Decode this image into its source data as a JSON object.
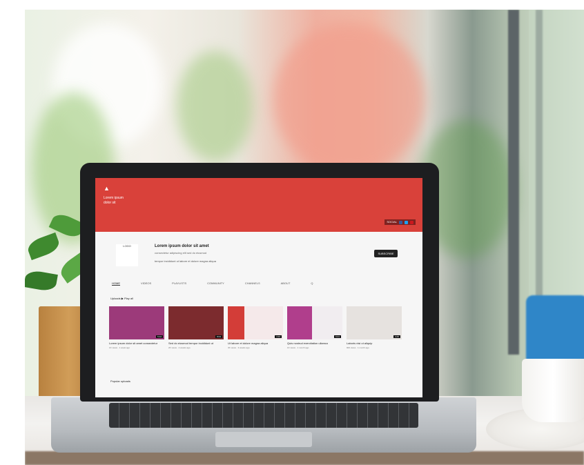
{
  "banner": {
    "logo_glyph": "▲",
    "brand_line_1": "Lorem ipsum",
    "brand_line_2": "dolor sit",
    "links": [
      "SOCIAL",
      "f",
      "t",
      "▶"
    ],
    "social_colors": [
      "#3b5998",
      "#1da1f2",
      "#cc181e"
    ]
  },
  "channel": {
    "avatar_text": "LOGO",
    "title": "Lorem ipsum dolor sit amet",
    "subtitle": "consectetur adipiscing elit sed do eiusmod",
    "description": "tempor incididunt ut labore et dolore magna aliqua",
    "subscribe_label": "SUBSCRIBE"
  },
  "tabs": [
    "HOME",
    "VIDEOS",
    "PLAYLISTS",
    "COMMUNITY",
    "CHANNELS",
    "ABOUT",
    "Q"
  ],
  "section_title": "Uploads ▶ Play all",
  "videos": [
    {
      "title": "Lorem ipsum dolor sit amet consectetur",
      "meta": "1K views · 1 week ago",
      "duration": "5:12",
      "thumb_color": "#9c3a7a"
    },
    {
      "title": "Sed do eiusmod tempor incididunt ut",
      "meta": "2K views · 2 weeks ago",
      "duration": "8:04",
      "thumb_color": "#7c2b2e"
    },
    {
      "title": "Ut labore et dolore magna aliqua",
      "meta": "3K views · 3 weeks ago",
      "duration": "4:33",
      "thumb_color": "#d33d38"
    },
    {
      "title": "Quis nostrud exercitation ullamco",
      "meta": "1K views · 1 month ago",
      "duration": "6:21",
      "thumb_color": "#b03e8c"
    },
    {
      "title": "Laboris nisi ut aliquip",
      "meta": "900 views · 1 month ago",
      "duration": "3:45",
      "thumb_color": "#e6e2df"
    }
  ],
  "section2_title": "Popular uploads"
}
